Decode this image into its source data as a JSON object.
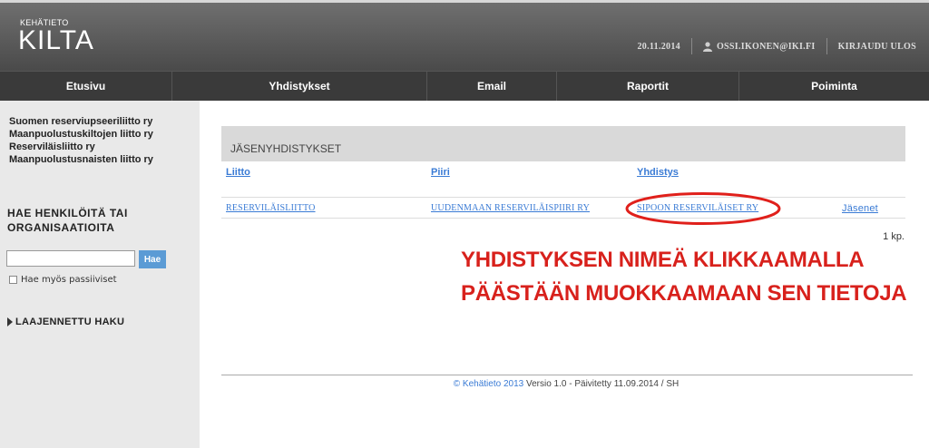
{
  "header": {
    "logo_small": "KEHÄTIETO",
    "logo_main": "KILTA",
    "date": "20.11.2014",
    "user": "OSSI.IKONEN@IKI.FI",
    "logout": "KIRJAUDU ULOS"
  },
  "nav": [
    {
      "label": "Etusivu"
    },
    {
      "label": "Yhdistykset"
    },
    {
      "label": "Email"
    },
    {
      "label": "Raportit"
    },
    {
      "label": "Poiminta"
    }
  ],
  "sidebar": {
    "orgs": [
      "Suomen reserviupseeriliitto ry",
      "Maanpuolustuskiltojen liitto ry",
      "Reserviläisliitto ry",
      "Maanpuolustusnaisten liitto ry"
    ],
    "search_title": "HAE HENKILÖITÄ TAI ORGANISAATIOITA",
    "search_value": "",
    "search_button": "Hae",
    "passive_label": "Hae myös passiiviset",
    "advanced": "LAAJENNETTU HAKU"
  },
  "main": {
    "panel_title": "JÄSENYHDISTYKSET",
    "columns": [
      "Liitto",
      "Piiri",
      "Yhdistys"
    ],
    "row": {
      "liitto": "RESERVILÄISLIITTO",
      "piiri": "UUDENMAAN RESERVILÄISPIIRI RY",
      "yhdistys": "SIPOON RESERVILÄISET RY",
      "jasenet": "Jäsenet"
    },
    "count": "1 kp.",
    "annotation": "YHDISTYKSEN NIMEÄ KLIKKAAMALLA PÄÄSTÄÄN MUOKKAAMAAN SEN TIETOJA",
    "annotation_color": "#d8211c"
  },
  "footer": {
    "copyright": "© Kehätieto 2013",
    "version": " Versio 1.0 - Päivitetty 11.09.2014 / SH"
  }
}
